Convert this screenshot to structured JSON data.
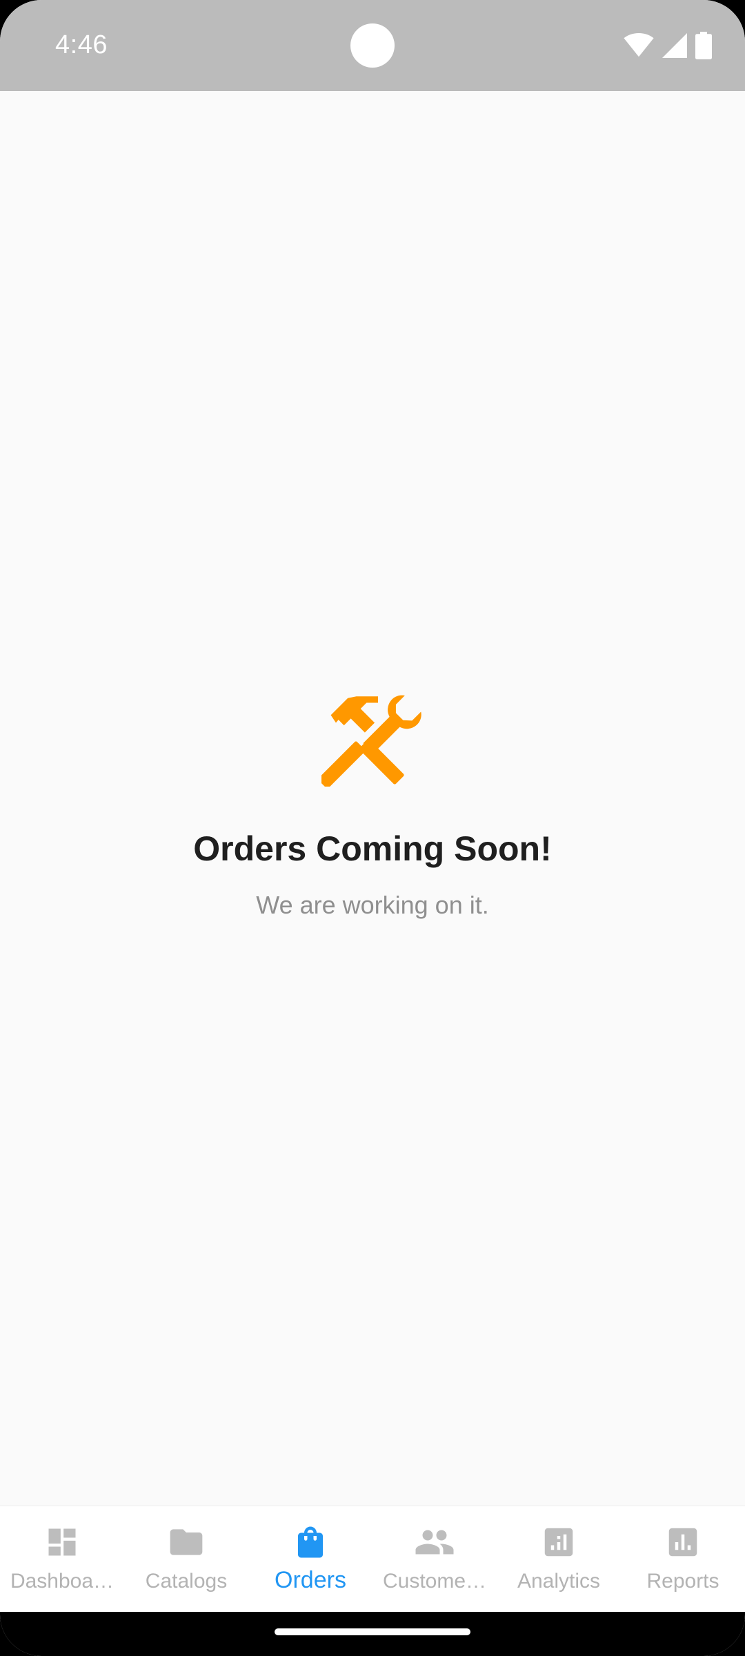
{
  "status_bar": {
    "time": "4:46",
    "icons": [
      "wifi-icon",
      "cellular-signal-icon",
      "battery-icon"
    ]
  },
  "empty_state": {
    "icon": "tools-icon",
    "icon_color": "#ff9800",
    "title": "Orders Coming Soon!",
    "subtitle": "We are working on it."
  },
  "bottom_nav": {
    "active_color": "#2196f3",
    "inactive_color": "#b3b3b3",
    "items": [
      {
        "label": "Dashboa…",
        "icon": "dashboard-icon",
        "active": false
      },
      {
        "label": "Catalogs",
        "icon": "folder-icon",
        "active": false
      },
      {
        "label": "Orders",
        "icon": "shopping-bag-icon",
        "active": true
      },
      {
        "label": "Custome…",
        "icon": "people-icon",
        "active": false
      },
      {
        "label": "Analytics",
        "icon": "analytics-icon",
        "active": false
      },
      {
        "label": "Reports",
        "icon": "bar-chart-icon",
        "active": false
      }
    ]
  }
}
